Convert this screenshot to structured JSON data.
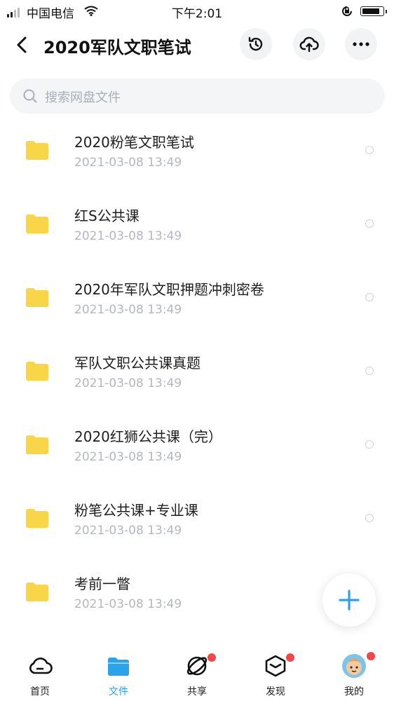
{
  "status_bar": {
    "carrier": "中国电信",
    "time": "下午2:01"
  },
  "header": {
    "title": "2020军队文职笔试"
  },
  "search": {
    "placeholder": "搜索网盘文件"
  },
  "files": [
    {
      "name": "2020粉笔文职笔试",
      "date": "2021-03-08 13:49"
    },
    {
      "name": "红S公共课",
      "date": "2021-03-08 13:49"
    },
    {
      "name": "2020年军队文职押题冲刺密卷",
      "date": "2021-03-08 13:49"
    },
    {
      "name": "军队文职公共课真题",
      "date": "2021-03-08 13:49"
    },
    {
      "name": "2020红狮公共课（完）",
      "date": "2021-03-08 13:49"
    },
    {
      "name": "粉笔公共课+专业课",
      "date": "2021-03-08 13:49"
    },
    {
      "name": "考前一瞥",
      "date": "2021-03-08 13:49"
    }
  ],
  "bottom_nav": [
    {
      "label": "首页",
      "icon": "cloud-icon"
    },
    {
      "label": "文件",
      "icon": "folder-icon",
      "active": true
    },
    {
      "label": "共享",
      "icon": "share-orbit-icon",
      "badge": true
    },
    {
      "label": "发现",
      "icon": "discover-cube-icon",
      "badge": true
    },
    {
      "label": "我的",
      "icon": "avatar-icon",
      "badge": true
    }
  ],
  "colors": {
    "accent": "#2aa3ea",
    "folder": "#f9d648",
    "badge": "#f04848"
  }
}
